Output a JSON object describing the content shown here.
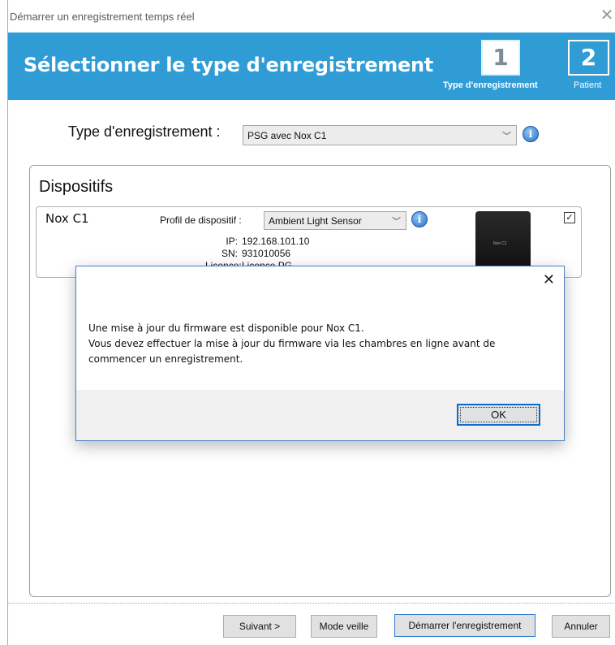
{
  "window": {
    "title": "Démarrer un enregistrement temps réel",
    "close_glyph": "✕"
  },
  "header": {
    "title": "Sélectionner le type d'enregistrement",
    "steps": [
      {
        "number": "1",
        "label": "Type d'enregistrement",
        "active": true
      },
      {
        "number": "2",
        "label": "Patient",
        "active": false
      }
    ]
  },
  "recording_type": {
    "label": "Type d'enregistrement :",
    "value": "PSG avec Nox C1",
    "info_icon": "info-icon"
  },
  "devices": {
    "title": "Dispositifs",
    "items": [
      {
        "name": "Nox C1",
        "profile_label": "Profil de dispositif :",
        "profile_value": "Ambient Light Sensor",
        "ip_key": "IP:",
        "ip": "192.168.101.10",
        "sn_key": "SN:",
        "sn": "931010056",
        "license_key": "Licence:",
        "license": "Licence PG",
        "image_label": "Nox C1",
        "checked": true
      }
    ]
  },
  "buttons": {
    "next": "Suivant >",
    "sleep": "Mode veille",
    "start": "Démarrer l'enregistrement",
    "cancel": "Annuler"
  },
  "dialog": {
    "close_glyph": "✕",
    "line1": "Une mise à jour du firmware est disponible pour Nox C1.",
    "line2": "Vous devez effectuer la mise à jour du firmware via les chambres en ligne avant de",
    "line3": "commencer un enregistrement.",
    "ok": "OK"
  },
  "colors": {
    "header": "#2f9cd6",
    "focus": "#0e6ad3"
  }
}
